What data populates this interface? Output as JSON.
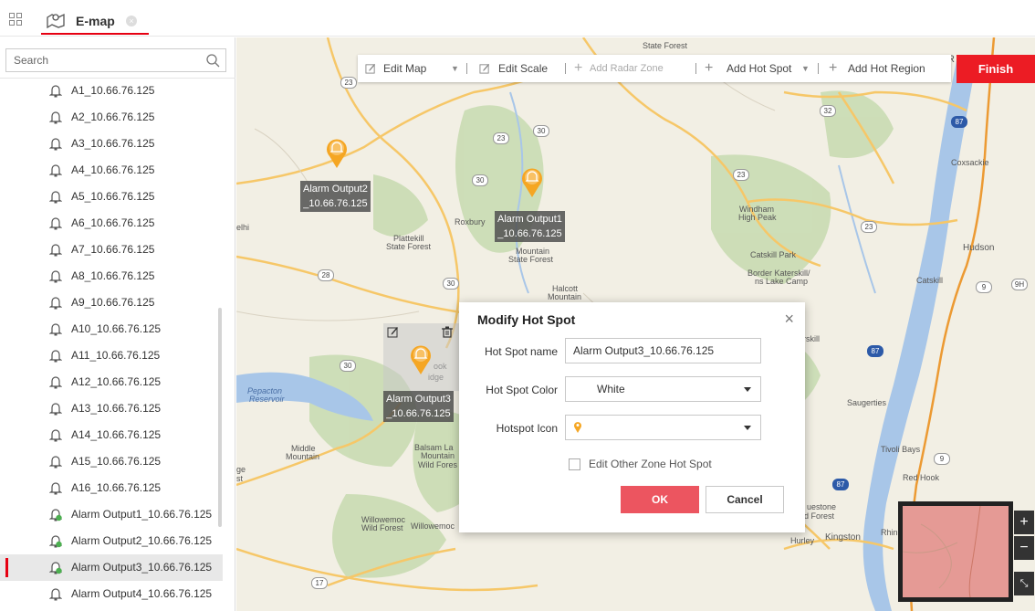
{
  "tabs": [
    {
      "label": "E-map"
    }
  ],
  "sidebar": {
    "search_placeholder": "Search",
    "items": [
      {
        "label": "A1_10.66.76.125",
        "type": "alarm-input"
      },
      {
        "label": "A2_10.66.76.125",
        "type": "alarm-input"
      },
      {
        "label": "A3_10.66.76.125",
        "type": "alarm-input"
      },
      {
        "label": "A4_10.66.76.125",
        "type": "alarm-input"
      },
      {
        "label": "A5_10.66.76.125",
        "type": "alarm-input"
      },
      {
        "label": "A6_10.66.76.125",
        "type": "alarm-input"
      },
      {
        "label": "A7_10.66.76.125",
        "type": "alarm-input"
      },
      {
        "label": "A8_10.66.76.125",
        "type": "alarm-input"
      },
      {
        "label": "A9_10.66.76.125",
        "type": "alarm-input"
      },
      {
        "label": "A10_10.66.76.125",
        "type": "alarm-input"
      },
      {
        "label": "A11_10.66.76.125",
        "type": "alarm-input"
      },
      {
        "label": "A12_10.66.76.125",
        "type": "alarm-input"
      },
      {
        "label": "A13_10.66.76.125",
        "type": "alarm-input"
      },
      {
        "label": "A14_10.66.76.125",
        "type": "alarm-input"
      },
      {
        "label": "A15_10.66.76.125",
        "type": "alarm-input"
      },
      {
        "label": "A16_10.66.76.125",
        "type": "alarm-input"
      },
      {
        "label": "Alarm Output1_10.66.76.125",
        "type": "alarm-output-added"
      },
      {
        "label": "Alarm Output2_10.66.76.125",
        "type": "alarm-output-added"
      },
      {
        "label": "Alarm Output3_10.66.76.125",
        "type": "alarm-output-added",
        "selected": true
      },
      {
        "label": "Alarm Output4_10.66.76.125",
        "type": "alarm-input"
      }
    ]
  },
  "toolbar": {
    "edit_map": "Edit Map",
    "edit_scale": "Edit Scale",
    "add_radar_zone": "Add Radar Zone",
    "add_hot_spot": "Add Hot Spot",
    "add_hot_region": "Add Hot Region",
    "finish": "Finish"
  },
  "hotspots": {
    "hs1": {
      "line1": "Alarm Output1",
      "line2": "_10.66.76.125"
    },
    "hs2": {
      "line1": "Alarm Output2",
      "line2": "_10.66.76.125"
    },
    "hs3": {
      "line1": "Alarm Output3",
      "line2": "_10.66.76.125"
    }
  },
  "map_labels": {
    "delhi": "elhi",
    "roxbury": "Roxbury",
    "plattekill": "Plattekill",
    "plattekill2": "State Forest",
    "mountain": "Mountain",
    "mountain2": "State Forest",
    "halcott": "Halcott",
    "halcott2": "Mountain",
    "windham": "Windham",
    "windham2": "High Peak",
    "catskill_park": "Catskill Park",
    "border": "Border Katerskill/",
    "border2": "ns Lake Camp",
    "coxsackie": "Coxsackie",
    "hudson": "Hudson",
    "catskill": "Catskill",
    "saugerties": "Saugerties",
    "tivoli": "Tivoli Bays",
    "red_hook": "Red Hook",
    "kingston": "Kingston",
    "hurley": "Hurley",
    "rhin": "Rhin",
    "pepacton": "Pepacton",
    "pepacton2": "Reservoir",
    "middle": "Middle",
    "middle2": "Mountain",
    "balsam": "Balsam La",
    "balsam2": "Mountain",
    "balsam3": "Wild Fores",
    "willowemoc": "Willowemoc",
    "willowemoc2": "Wild Forest",
    "willowemoc3": "Willowemoc",
    "ge": "ge",
    "st": "st",
    "uestone": "uestone",
    "dforest": "d Forest",
    "rskill": "rskill",
    "ook": "ook",
    "idge": "idge",
    "r": "R",
    "state_forest": "State Forest",
    "route_23a": "23",
    "route_23b": "23",
    "route_30a": "30",
    "route_30b": "30",
    "route_30c": "30",
    "route_30d": "30",
    "route_28": "28",
    "route_32": "32",
    "route_23c": "23",
    "route_23d": "23",
    "route_87a": "87",
    "route_87b": "87",
    "route_87c": "87",
    "route_9": "9",
    "route_9h": "9H",
    "route_9b": "9",
    "route_17": "17"
  },
  "dialog": {
    "title": "Modify Hot Spot",
    "name_label": "Hot Spot name",
    "name_value": "Alarm Output3_10.66.76.125",
    "color_label": "Hot Spot Color",
    "color_value": "White",
    "icon_label": "Hotspot Icon",
    "edit_other_label": "Edit Other Zone Hot Spot",
    "edit_other_checked": false,
    "ok": "OK",
    "cancel": "Cancel"
  },
  "zoom": {
    "in": "+",
    "out": "−"
  },
  "colors": {
    "accent": "#e60012",
    "finish": "#ec1c24",
    "ok": "#ec5560",
    "hotspot": "#f5a623",
    "device_green": "#4caf50"
  }
}
